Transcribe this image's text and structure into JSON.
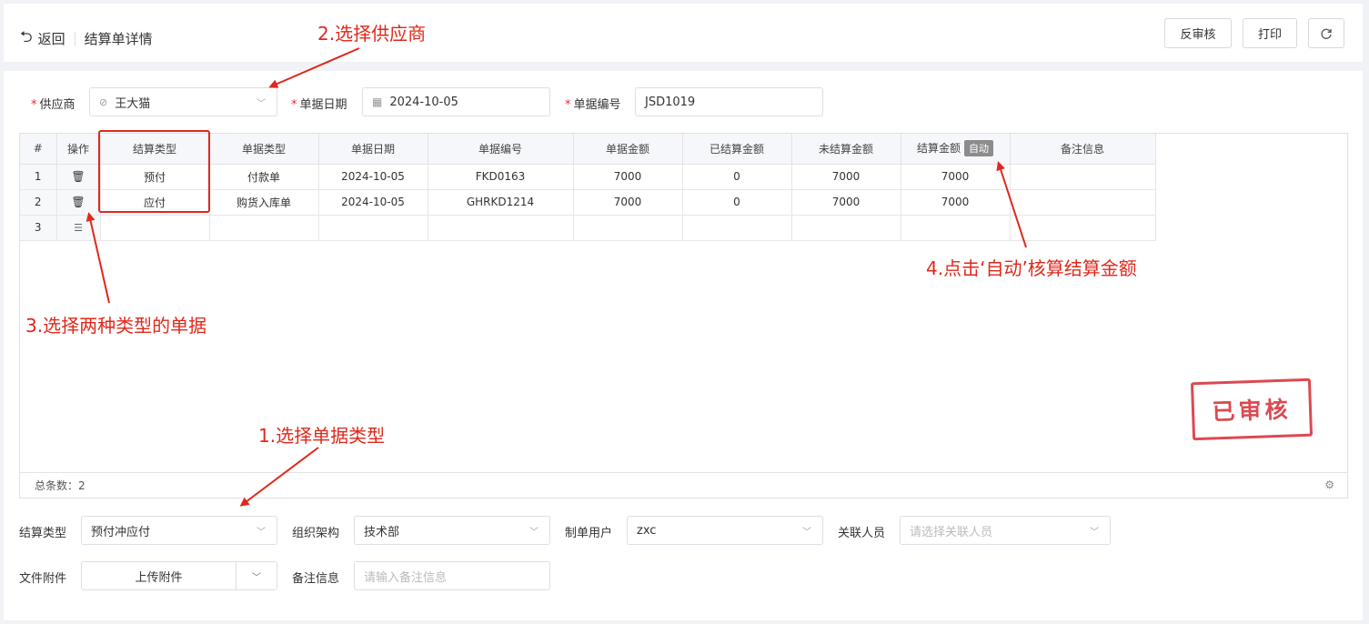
{
  "header": {
    "back_label": "返回",
    "title": "结算单详情",
    "btn_unaudit": "反审核",
    "btn_print": "打印",
    "refresh_icon": "refresh-icon"
  },
  "form": {
    "supplier_label": "供应商",
    "supplier_value": "王大猫",
    "date_label": "单据日期",
    "date_value": "2024-10-05",
    "number_label": "单据编号",
    "number_value": "JSD1019"
  },
  "table": {
    "columns": [
      "#",
      "操作",
      "结算类型",
      "单据类型",
      "单据日期",
      "单据编号",
      "单据金额",
      "已结算金额",
      "未结算金额",
      "结算金额",
      "备注信息"
    ],
    "auto_label": "自动",
    "rows": [
      {
        "no": "1",
        "settle_type": "预付",
        "doc_type": "付款单",
        "date": "2024-10-05",
        "doc_no": "FKD0163",
        "amount": "7000",
        "settled": "0",
        "unsettled": "7000",
        "settle_amount": "7000",
        "remark": ""
      },
      {
        "no": "2",
        "settle_type": "应付",
        "doc_type": "购货入库单",
        "date": "2024-10-05",
        "doc_no": "GHRKD1214",
        "amount": "7000",
        "settled": "0",
        "unsettled": "7000",
        "settle_amount": "7000",
        "remark": ""
      },
      {
        "no": "3",
        "settle_type": "",
        "doc_type": "",
        "date": "",
        "doc_no": "",
        "amount": "",
        "settled": "",
        "unsettled": "",
        "settle_amount": "",
        "remark": ""
      }
    ],
    "footer_total": "总条数：2"
  },
  "stamp": "已审核",
  "bottom": {
    "settle_type_label": "结算类型",
    "settle_type_value": "预付冲应付",
    "org_label": "组织架构",
    "org_value": "技术部",
    "maker_label": "制单用户",
    "maker_value": "zxc",
    "related_label": "关联人员",
    "related_placeholder": "请选择关联人员",
    "attach_label": "文件附件",
    "attach_button": "上传附件",
    "remark_label": "备注信息",
    "remark_placeholder": "请输入备注信息"
  },
  "annotations": {
    "a1": "1.选择单据类型",
    "a2": "2.选择供应商",
    "a3": "3.选择两种类型的单据",
    "a4": "4.点击‘自动’核算结算金额"
  },
  "colors": {
    "annotation_red": "#e0281b",
    "stamp_red": "#d9363e"
  }
}
